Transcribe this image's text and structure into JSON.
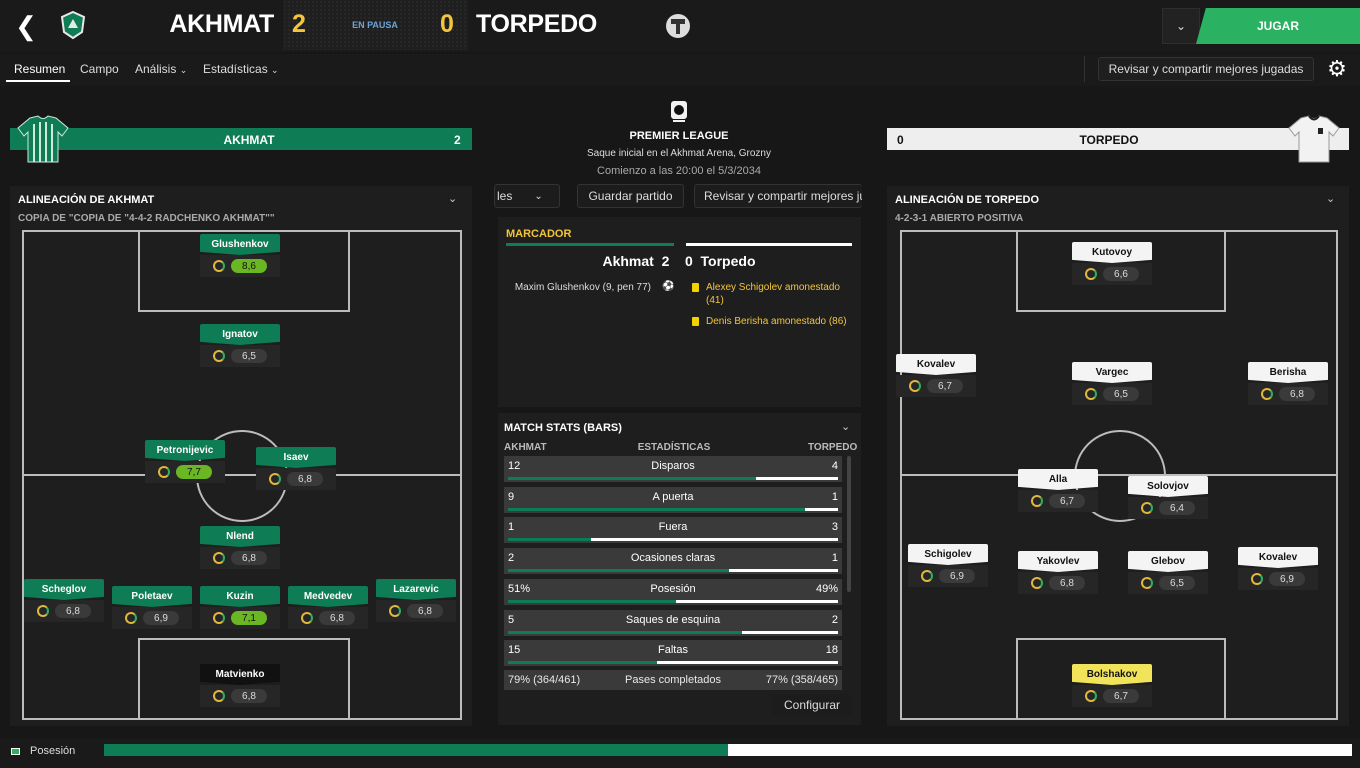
{
  "header": {
    "home_name": "AKHMAT",
    "away_name": "TORPEDO",
    "home_score": "2",
    "away_score": "0",
    "status": "EN PAUSA",
    "play_label": "JUGAR"
  },
  "nav": {
    "tabs": [
      "Resumen",
      "Campo",
      "Análisis",
      "Estadísticas"
    ],
    "review_label": "Revisar y compartir mejores jugadas"
  },
  "center": {
    "league": "PREMIER LEAGUE",
    "kickoff": "Saque inicial en el Akhmat Arena, Grozny",
    "start_time": "Comienzo a las 20:00 el 5/3/2034",
    "btn_partial": "les",
    "btn_save": "Guardar partido",
    "btn_review": "Revisar y compartir mejores ju"
  },
  "marcador": {
    "title": "MARCADOR",
    "home": "Akhmat",
    "home_goals": "2",
    "away_goals": "0",
    "away": "Torpedo",
    "home_event": "Maxim Glushenkov (9, pen 77)",
    "away_events": [
      "Alexey Schigolev amonestado (41)",
      "Denis Berisha amonestado (86)"
    ]
  },
  "stats": {
    "title": "MATCH STATS (BARS)",
    "hdr_home": "AKHMAT",
    "hdr_mid": "ESTADÍSTICAS",
    "hdr_away": "TORPEDO",
    "rows": [
      {
        "label": "Disparos",
        "home": "12",
        "away": "4",
        "home_share": 0.75
      },
      {
        "label": "A puerta",
        "home": "9",
        "away": "1",
        "home_share": 0.9
      },
      {
        "label": "Fuera",
        "home": "1",
        "away": "3",
        "home_share": 0.25
      },
      {
        "label": "Ocasiones claras",
        "home": "2",
        "away": "1",
        "home_share": 0.67
      },
      {
        "label": "Posesión",
        "home": "51%",
        "away": "49%",
        "home_share": 0.51
      },
      {
        "label": "Saques de esquina",
        "home": "5",
        "away": "2",
        "home_share": 0.71
      },
      {
        "label": "Faltas",
        "home": "15",
        "away": "18",
        "home_share": 0.45
      }
    ],
    "passes": {
      "label": "Pases completados",
      "home": "79% (364/461)",
      "away": "77% (358/465)"
    },
    "config_label": "Configurar"
  },
  "home_panel": {
    "bar_name": "AKHMAT",
    "bar_score": "2",
    "title": "ALINEACIÓN DE AKHMAT",
    "formation": "COPIA DE \"COPIA DE \"4-4-2 RADCHENKO AKHMAT\"\"",
    "players": [
      {
        "name": "Glushenkov",
        "rating": "8,6",
        "good": true
      },
      {
        "name": "Ignatov",
        "rating": "6,5"
      },
      {
        "name": "Petronijevic",
        "rating": "7,7",
        "good": true
      },
      {
        "name": "Isaev",
        "rating": "6,8"
      },
      {
        "name": "Nlend",
        "rating": "6,8"
      },
      {
        "name": "Scheglov",
        "rating": "6,8"
      },
      {
        "name": "Poletaev",
        "rating": "6,9"
      },
      {
        "name": "Kuzin",
        "rating": "7,1",
        "good": true
      },
      {
        "name": "Medvedev",
        "rating": "6,8"
      },
      {
        "name": "Lazarevic",
        "rating": "6,8"
      },
      {
        "name": "Matvienko",
        "rating": "6,8"
      }
    ]
  },
  "away_panel": {
    "bar_name": "TORPEDO",
    "bar_score": "0",
    "title": "ALINEACIÓN DE TORPEDO",
    "formation": "4-2-3-1 ABIERTO POSITIVA",
    "players": [
      {
        "name": "Kutovoy",
        "rating": "6,6"
      },
      {
        "name": "Kovalev",
        "rating": "6,7"
      },
      {
        "name": "Vargec",
        "rating": "6,5"
      },
      {
        "name": "Berisha",
        "rating": "6,8"
      },
      {
        "name": "Alla",
        "rating": "6,7"
      },
      {
        "name": "Solovjov",
        "rating": "6,4"
      },
      {
        "name": "Schigolev",
        "rating": "6,9"
      },
      {
        "name": "Yakovlev",
        "rating": "6,8"
      },
      {
        "name": "Glebov",
        "rating": "6,5"
      },
      {
        "name": "Kovalev",
        "rating": "6,9"
      },
      {
        "name": "Bolshakov",
        "rating": "6,7"
      }
    ]
  },
  "bottom": {
    "label": "Posesión",
    "home_share": 0.5
  },
  "colors": {
    "home": "#0e7c55",
    "accent": "#2bb162",
    "score": "#f3c53a"
  }
}
